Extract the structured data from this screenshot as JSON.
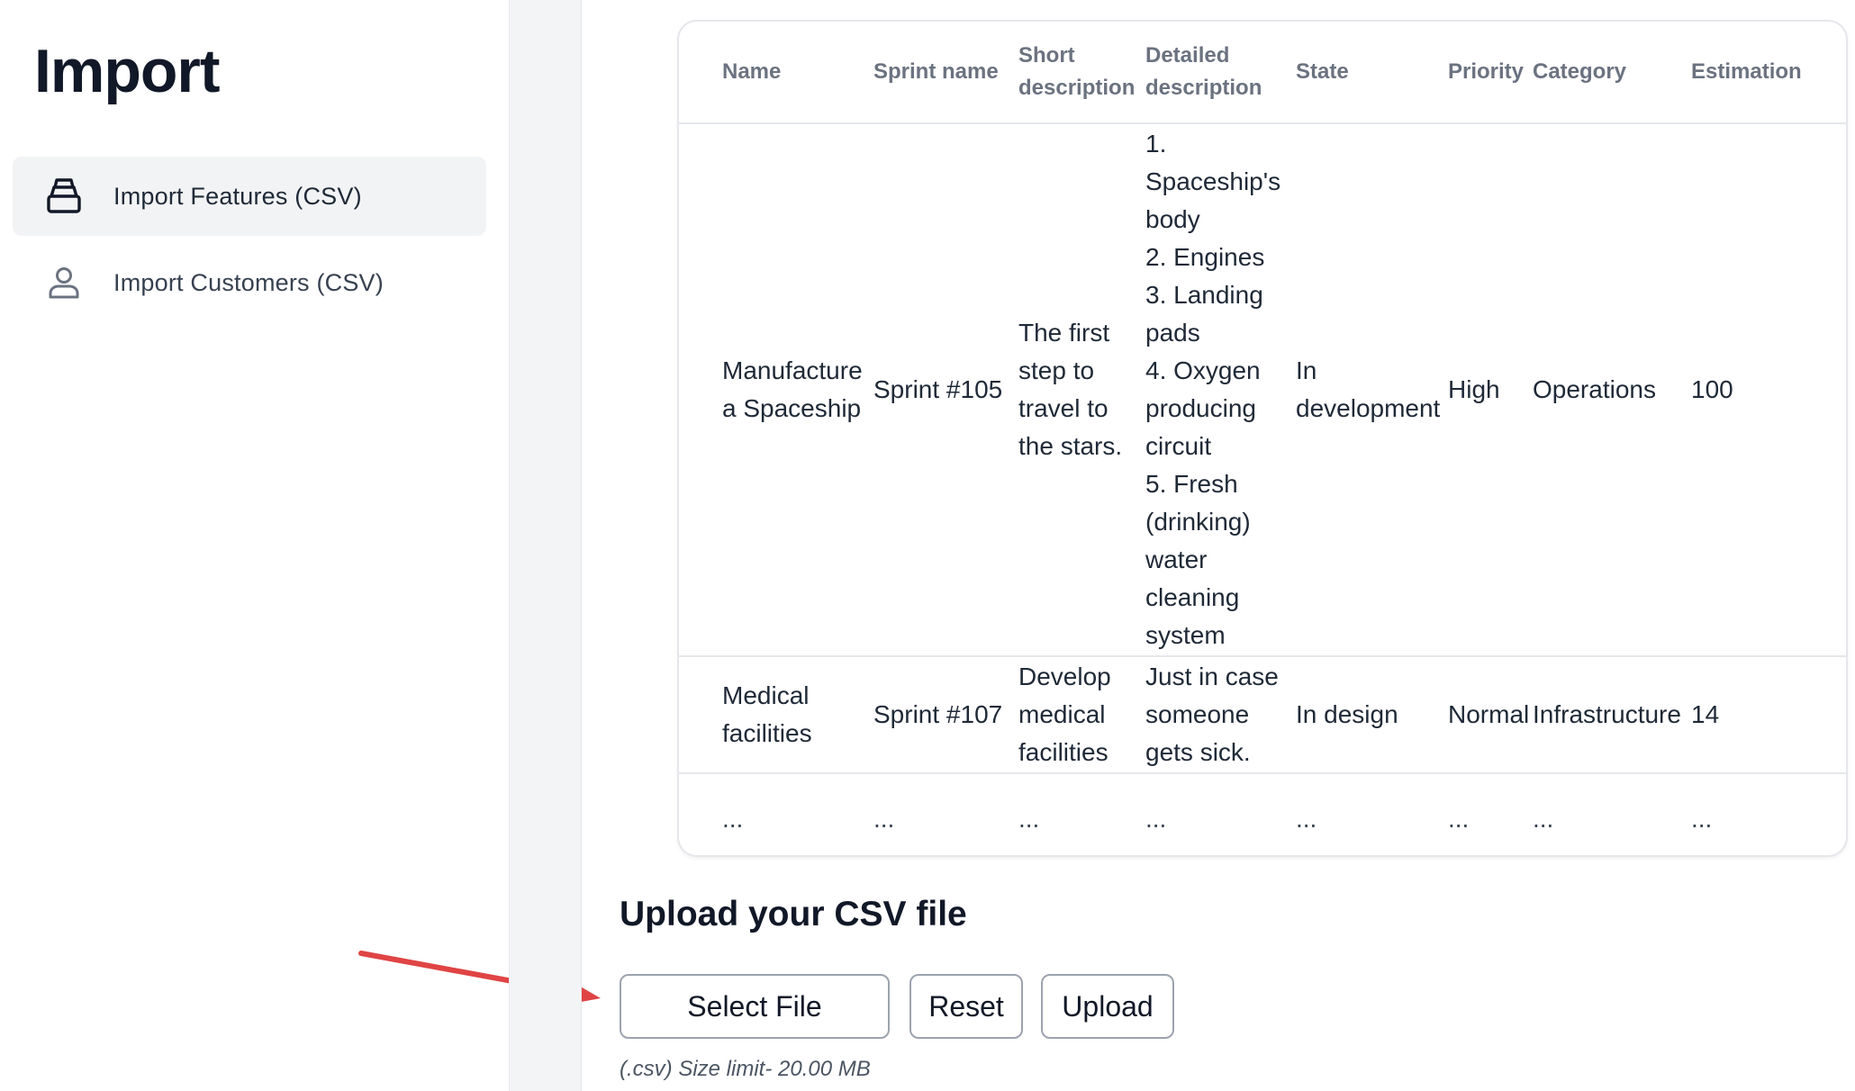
{
  "sidebar": {
    "title": "Import",
    "items": [
      {
        "label": "Import Features (CSV)",
        "icon": "layers-icon",
        "active": true
      },
      {
        "label": "Import Customers (CSV)",
        "icon": "user-icon",
        "active": false
      }
    ]
  },
  "table": {
    "headers": {
      "name": "Name",
      "sprint_name": "Sprint name",
      "short_description": "Short description",
      "detailed_description": "Detailed description",
      "state": "State",
      "priority": "Priority",
      "category": "Category",
      "estimation": "Estimation"
    },
    "rows": [
      {
        "name": "Manufacture a Spaceship",
        "sprint_name": "Sprint #105",
        "short_description": "The first step to travel to the stars.",
        "detailed_description": "1. Spaceship's body\n2. Engines\n3. Landing pads\n4. Oxygen producing circuit\n5. Fresh (drinking) water cleaning system",
        "state": "In development",
        "priority": "High",
        "category": "Operations",
        "estimation": "100"
      },
      {
        "name": "Medical facilities",
        "sprint_name": "Sprint #107",
        "short_description": "Develop medical facilities",
        "detailed_description": "Just in case someone gets sick.",
        "state": "In design",
        "priority": "Normal",
        "category": "Infrastructure",
        "estimation": "14"
      },
      {
        "name": "...",
        "sprint_name": "...",
        "short_description": "...",
        "detailed_description": "...",
        "state": "...",
        "priority": "...",
        "category": "...",
        "estimation": "..."
      }
    ]
  },
  "upload": {
    "heading": "Upload your CSV file",
    "select_label": "Select File",
    "reset_label": "Reset",
    "upload_label": "Upload",
    "hint": "(.csv) Size limit- 20.00 MB"
  },
  "colors": {
    "annotation_arrow": "#e04444",
    "active_nav_bg": "#f2f3f5",
    "gutter_bg": "#f3f4f6"
  }
}
